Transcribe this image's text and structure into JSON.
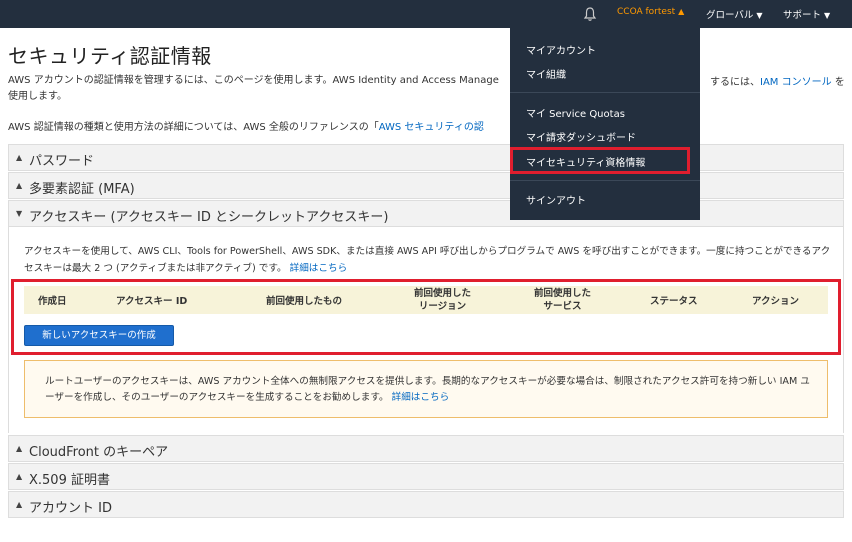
{
  "topbar": {
    "account": "CCOA fortest",
    "region": "グローバル",
    "support": "サポート"
  },
  "page": {
    "title": "セキュリティ認証情報",
    "intro_line1": "AWS アカウントの認証情報を管理するには、このページを使用します。AWS Identity and Access Manage",
    "intro_right_prefix": "するには、",
    "intro_right_link": "IAM コンソール",
    "intro_right_suffix": " を",
    "intro_line2": "使用します。",
    "ref_text": "AWS 認証情報の種類と使用方法の詳細については、AWS 全般のリファレンスの「",
    "ref_link": "AWS セキュリティの認"
  },
  "sections": {
    "password": "パスワード",
    "mfa": "多要素認証 (MFA)",
    "access_keys": "アクセスキー (アクセスキー ID とシークレットアクセスキー)",
    "cloudfront": "CloudFront のキーペア",
    "x509": "X.509 証明書",
    "account_id": "アカウント ID"
  },
  "access_keys_panel": {
    "description": "アクセスキーを使用して、AWS CLI、Tools for PowerShell、AWS SDK、または直接 AWS API 呼び出しからプログラムで AWS を呼び出すことができます。一度に持つことができるアクセスキーは最大 2 つ (アクティブまたは非アクティブ) です。",
    "details_link": "詳細はこちら",
    "columns": [
      "作成日",
      "アクセスキー ID",
      "前回使用したもの",
      "前回使用した",
      "リージョン",
      "前回使用した",
      "サービス",
      "ステータス",
      "アクション"
    ],
    "create_button": "新しいアクセスキーの作成",
    "warning": "ルートユーザーのアクセスキーは、AWS アカウント全体への無制限アクセスを提供します。長期的なアクセスキーが必要な場合は、制限されたアクセス許可を持つ新しい IAM ユーザーを作成し、そのユーザーのアクセスキーを生成することをお勧めします。",
    "warning_link": "詳細はこちら"
  },
  "dropdown": {
    "items": [
      "マイアカウント",
      "マイ組織",
      "マイ Service Quotas",
      "マイ請求ダッシュボード",
      "マイセキュリティ資格情報",
      "サインアウト"
    ]
  },
  "colors": {
    "nav_bg": "#232f3e",
    "accent_orange": "#ff9900",
    "link_blue": "#0066c0",
    "highlight_red": "#e01e2e",
    "button_blue": "#1f6fce"
  },
  "icons": {
    "bell": "bell-icon",
    "caret": "caret-down-icon",
    "triangle_right": "triangle-up-icon",
    "triangle_down": "triangle-down-icon"
  }
}
